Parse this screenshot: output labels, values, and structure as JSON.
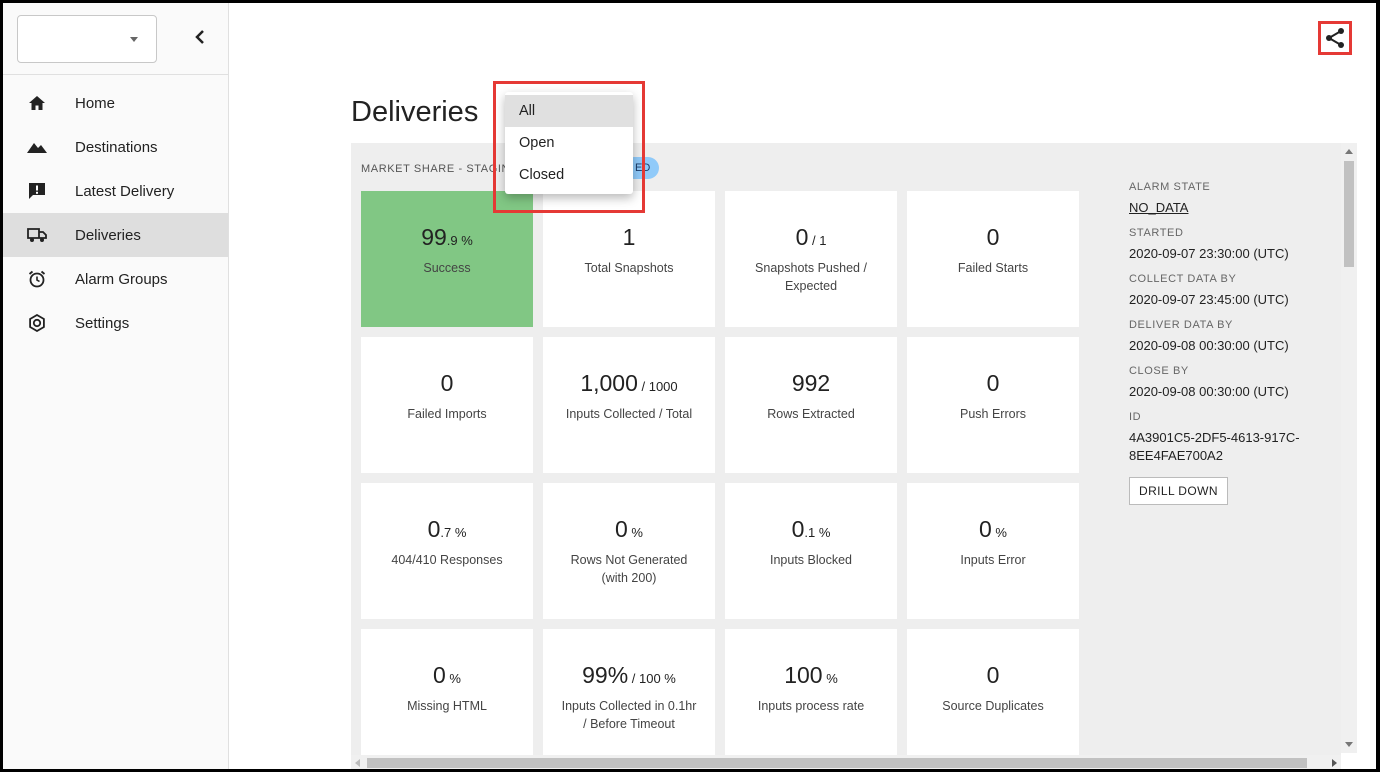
{
  "sidebar": {
    "items": [
      {
        "label": "Home",
        "icon": "home-icon"
      },
      {
        "label": "Destinations",
        "icon": "mountain-icon"
      },
      {
        "label": "Latest Delivery",
        "icon": "alert-message-icon"
      },
      {
        "label": "Deliveries",
        "icon": "truck-icon",
        "active": true
      },
      {
        "label": "Alarm Groups",
        "icon": "alarm-clock-icon"
      },
      {
        "label": "Settings",
        "icon": "gear-icon"
      }
    ]
  },
  "main": {
    "title": "Deliveries",
    "panel_label": "MARKET SHARE - STAGIN",
    "badge_text": "ED"
  },
  "dropdown": {
    "options": [
      "All",
      "Open",
      "Closed"
    ],
    "selected": "All"
  },
  "tiles": [
    {
      "value": "99",
      "suffix": ".9 %",
      "label": "Success"
    },
    {
      "value": "1",
      "suffix": "",
      "label": "Total Snapshots"
    },
    {
      "value": "0",
      "suffix": " / 1",
      "label": "Snapshots Pushed / Expected"
    },
    {
      "value": "0",
      "suffix": "",
      "label": "Failed Starts"
    },
    {
      "value": "0",
      "suffix": "",
      "label": "Failed Imports"
    },
    {
      "value": "1,000",
      "suffix": " / 1000",
      "label": "Inputs Collected / Total"
    },
    {
      "value": "992",
      "suffix": "",
      "label": "Rows Extracted"
    },
    {
      "value": "0",
      "suffix": "",
      "label": "Push Errors"
    },
    {
      "value": "0",
      "suffix": ".7 %",
      "label": "404/410 Responses"
    },
    {
      "value": "0",
      "suffix": " %",
      "label": "Rows Not Generated (with 200)"
    },
    {
      "value": "0",
      "suffix": ".1 %",
      "label": "Inputs Blocked"
    },
    {
      "value": "0",
      "suffix": " %",
      "label": "Inputs Error"
    },
    {
      "value": "0",
      "suffix": " %",
      "label": "Missing HTML"
    },
    {
      "value": "99%",
      "suffix": " / 100 %",
      "label": "Inputs Collected in 0.1hr / Before Timeout"
    },
    {
      "value": "100",
      "suffix": " %",
      "label": "Inputs process rate"
    },
    {
      "value": "0",
      "suffix": "",
      "label": "Source Duplicates"
    }
  ],
  "info": {
    "alarm_state_label": "ALARM STATE",
    "alarm_state_value": "NO_DATA",
    "started_label": "STARTED",
    "started_value": "2020-09-07 23:30:00 (UTC)",
    "collect_label": "COLLECT DATA BY",
    "collect_value": "2020-09-07 23:45:00 (UTC)",
    "deliver_label": "DELIVER DATA BY",
    "deliver_value": "2020-09-08 00:30:00 (UTC)",
    "close_label": "CLOSE BY",
    "close_value": "2020-09-08 00:30:00 (UTC)",
    "id_label": "ID",
    "id_value": "4A3901C5-2DF5-4613-917C-8EE4FAE700A2",
    "drill_label": "DRILL DOWN"
  },
  "colors": {
    "success_tile": "#81c784",
    "highlight": "#e53935",
    "badge": "#90caf9"
  }
}
